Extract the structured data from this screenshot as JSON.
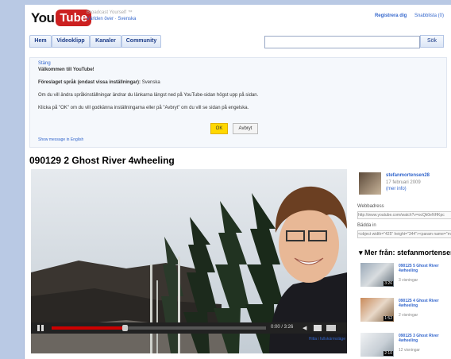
{
  "header": {
    "logo_you": "You",
    "logo_tube": "Tube",
    "tagline": "Broadcast Yourself ™",
    "region": "Världen över · Svenska",
    "links": [
      "Registrera dig",
      "Snabblista (0)"
    ]
  },
  "nav": {
    "tabs": [
      "Hem",
      "Videoklipp",
      "Kanaler",
      "Community"
    ],
    "search_placeholder": "",
    "search_button": "Sök"
  },
  "welcome": {
    "close_link": "Stäng",
    "heading": "Välkommen till YouTube!",
    "proposed_label": "Föreslaget språk (endast vissa inställningar):",
    "proposed_value": "Svenska",
    "line1": "Om du vill ändra språkinställningar ändrar du länkarna längst ned på YouTube-sidan högst upp på sidan.",
    "line2": "Klicka på \"OK\" om du vill godkänna inställningarna eller på \"Avbryt\" om du vill se sidan på engelska.",
    "ok_button": "OK",
    "cancel_button": "Avbryt",
    "english_link": "Show message in English"
  },
  "video": {
    "title": "090129 2 Ghost River 4wheeling",
    "time": "0:00 / 3:26",
    "progress_fraction": 0.34,
    "below_player": "Hitta i fullskärmsläge"
  },
  "sidebar": {
    "uploader": "stefanmortensen28",
    "date": "17 februari 2009",
    "more_info": "(mer info)",
    "url_label": "Webbadress",
    "url_value": "http://www.youtube.com/watch?v=ocQk0eNHKpc",
    "embed_label": "Bädda in",
    "embed_value": "<object width=\"425\" height=\"344\"><param name=\"movie\"",
    "more_from_prefix": "Mer från:",
    "more_from_name": "stefanmortensen28",
    "related": [
      {
        "title": "090125 5 Ghost River 4wheeling",
        "views": "3 visningar",
        "duration": "3:26"
      },
      {
        "title": "090125 4 Ghost River 4wheeling",
        "views": "2 visningar",
        "duration": "1:52"
      },
      {
        "title": "090125 3 Ghost River 4wheeling",
        "views": "12 visningar",
        "duration": "2:10"
      }
    ]
  },
  "colors": {
    "logo_red": "#cc2020",
    "link_blue": "#3366cc",
    "ok_yellow": "#ffd800",
    "progress_red": "#cc0000"
  }
}
